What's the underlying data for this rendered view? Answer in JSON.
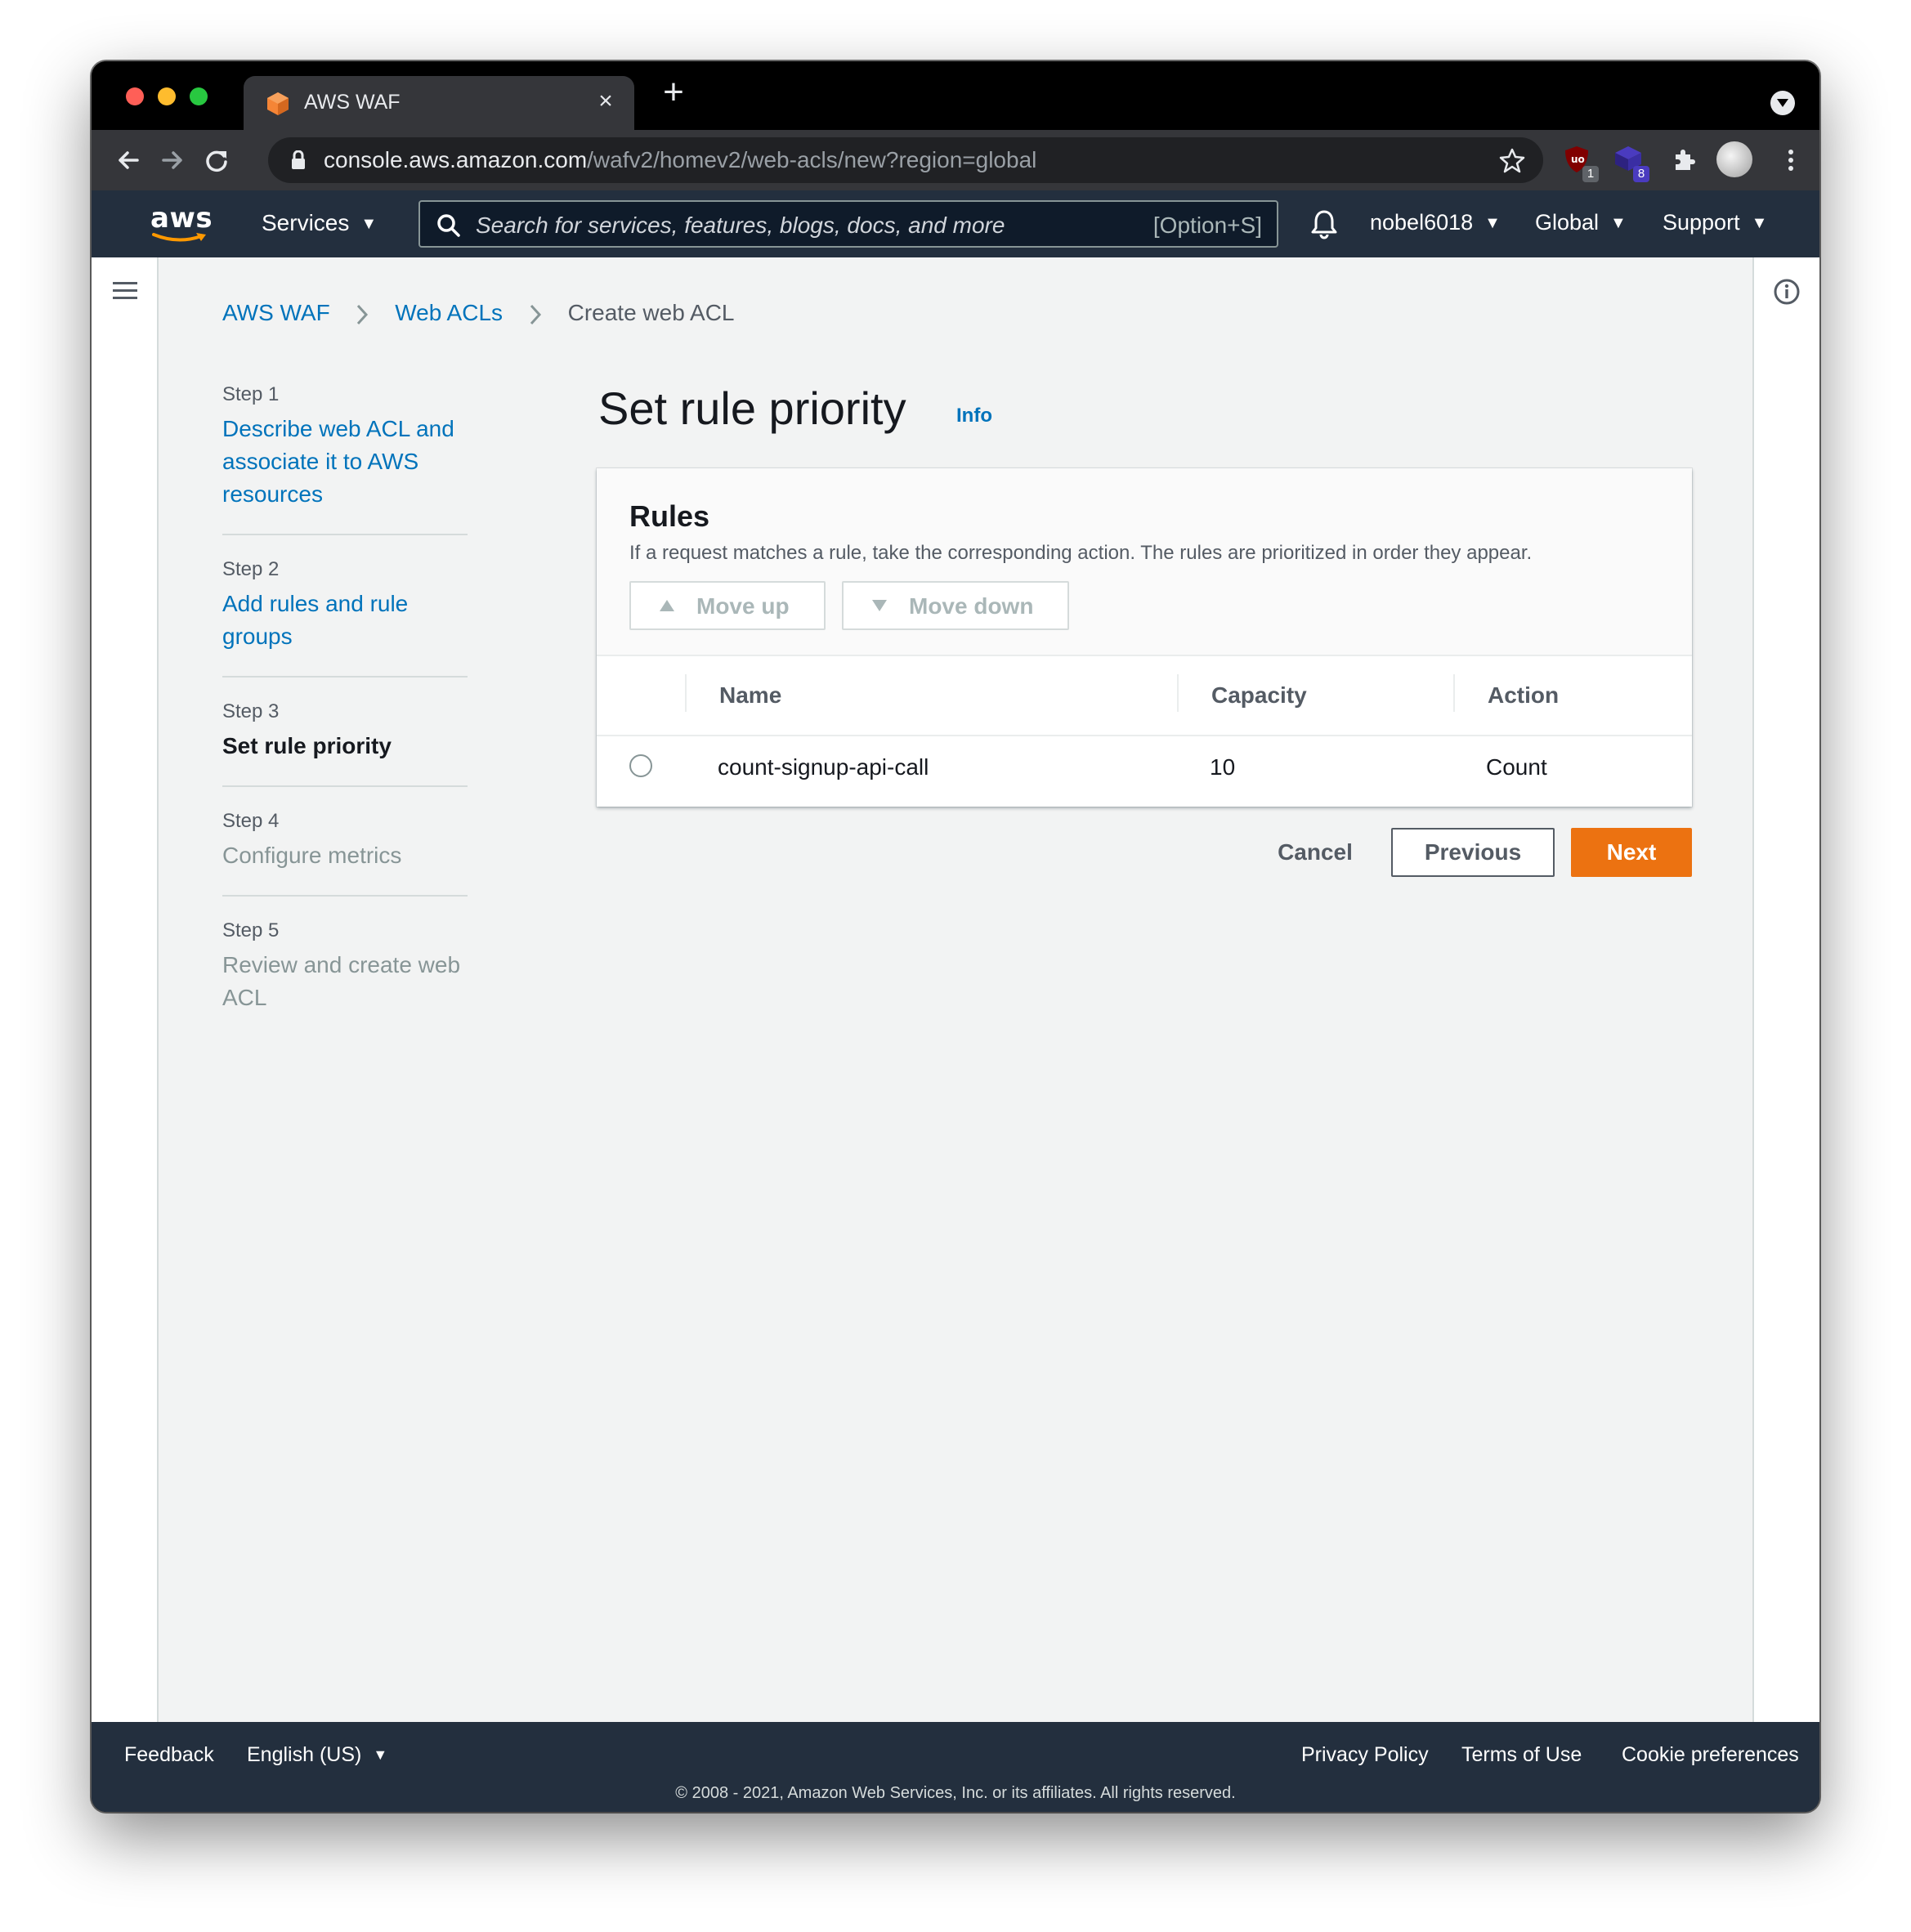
{
  "browser": {
    "tab_title": "AWS WAF",
    "tab_close": "×",
    "new_tab": "+",
    "url_host": "console.aws.amazon.com",
    "url_path": "/wafv2/homev2/web-acls/new?region=global",
    "ext_badges": {
      "ublock": "1",
      "cube": "8"
    }
  },
  "aws_header": {
    "logo": "aws",
    "services_label": "Services",
    "search_placeholder": "Search for services, features, blogs, docs, and more",
    "search_shortcut": "[Option+S]",
    "user": "nobel6018",
    "region": "Global",
    "support": "Support"
  },
  "breadcrumb": {
    "items": [
      "AWS WAF",
      "Web ACLs"
    ],
    "current": "Create web ACL"
  },
  "wizard_steps": [
    {
      "num": "Step 1",
      "label": "Describe web ACL and associate it to AWS resources",
      "state": "link"
    },
    {
      "num": "Step 2",
      "label": "Add rules and rule groups",
      "state": "link"
    },
    {
      "num": "Step 3",
      "label": "Set rule priority",
      "state": "current"
    },
    {
      "num": "Step 4",
      "label": "Configure metrics",
      "state": "disabled"
    },
    {
      "num": "Step 5",
      "label": "Review and create web ACL",
      "state": "disabled"
    }
  ],
  "main": {
    "title": "Set rule priority",
    "info": "Info",
    "rules_panel": {
      "title": "Rules",
      "description": "If a request matches a rule, take the corresponding action. The rules are prioritized in order they appear.",
      "move_up": "Move up",
      "move_down": "Move down",
      "columns": [
        "Name",
        "Capacity",
        "Action"
      ],
      "rows": [
        {
          "name": "count-signup-api-call",
          "capacity": "10",
          "action": "Count"
        }
      ]
    },
    "buttons": {
      "cancel": "Cancel",
      "previous": "Previous",
      "next": "Next"
    }
  },
  "footer": {
    "feedback": "Feedback",
    "language": "English (US)",
    "privacy": "Privacy Policy",
    "terms": "Terms of Use",
    "cookies": "Cookie preferences",
    "copyright": "© 2008 - 2021, Amazon Web Services, Inc. or its affiliates. All rights reserved."
  },
  "colors": {
    "aws_nav": "#232f3e",
    "link": "#0073bb",
    "primary_button": "#ec7211",
    "page_bg": "#f2f3f3"
  }
}
